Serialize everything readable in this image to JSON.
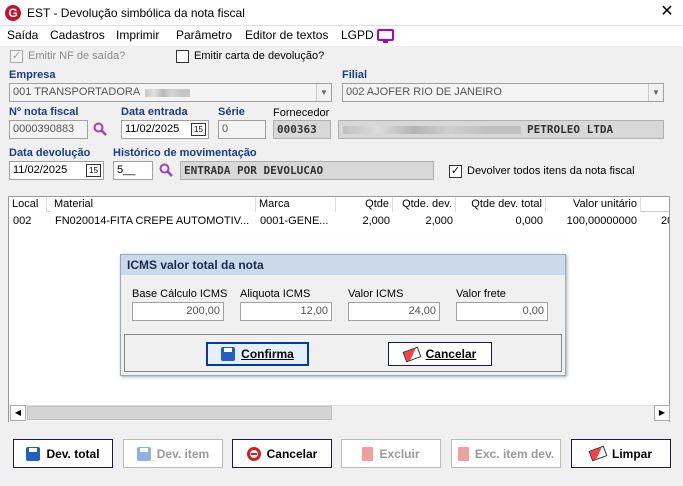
{
  "window": {
    "title": "EST - Devolução simbólica da nota fiscal",
    "app_icon_letter": "G"
  },
  "menu": [
    "Saída",
    "Cadastros",
    "Imprimir",
    "Parâmetro",
    "Editor de textos",
    "LGPD"
  ],
  "options": {
    "emitir_nf": "Emitir NF de saída?",
    "emitir_nf_checked": true,
    "emitir_carta": "Emitir carta de devolução?",
    "emitir_carta_checked": false
  },
  "form": {
    "empresa_label": "Empresa",
    "empresa_value": "001 TRANSPORTADORA",
    "filial_label": "Filial",
    "filial_value": "002 AJOFER RIO DE JANEIRO",
    "nota_label": "Nº nota fiscal",
    "nota_value": "0000390883",
    "data_entrada_label": "Data entrada",
    "data_entrada_value": "11/02/2025",
    "serie_label": "Série",
    "serie_value": "0",
    "fornecedor_label": "Fornecedor",
    "fornecedor_code": "000363",
    "fornecedor_name": "PETROLEO LTDA",
    "data_devolucao_label": "Data devolução",
    "data_devolucao_value": "11/02/2025",
    "historico_label": "Histórico de movimentação",
    "historico_code": "5__",
    "historico_desc": "ENTRADA POR DEVOLUCAO",
    "devolver_todos": "Devolver todos itens da nota fiscal",
    "devolver_todos_checked": true
  },
  "grid": {
    "headers": [
      "Local",
      "Material",
      "Marca",
      "Qtde",
      "Qtde. dev.",
      "Qtde dev. total",
      "Valor unitário"
    ],
    "rows": [
      [
        "002",
        "FN020014-FITA CREPE AUTOMOTIV...",
        "0001-GENE...",
        "2,000",
        "2,000",
        "0,000",
        "100,00000000",
        "20"
      ]
    ]
  },
  "dialog": {
    "title": "ICMS valor total da nota",
    "base_label": "Base Cálculo ICMS",
    "base_value": "200,00",
    "aliquota_label": "Aliquota ICMS",
    "aliquota_value": "12,00",
    "valor_label": "Valor ICMS",
    "valor_value": "24,00",
    "frete_label": "Valor frete",
    "frete_value": "0,00",
    "confirm": "Confirma",
    "cancel": "Cancelar"
  },
  "buttons": {
    "dev_total": "Dev. total",
    "dev_item": "Dev. item",
    "cancelar": "Cancelar",
    "excluir": "Excluir",
    "exc_item_dev": "Exc. item dev.",
    "limpar": "Limpar"
  },
  "colors": {
    "label_blue": "#1a3c8c",
    "dialog_title_bg": "#cbd9ea",
    "disabled_gray": "#9a9a9a"
  }
}
